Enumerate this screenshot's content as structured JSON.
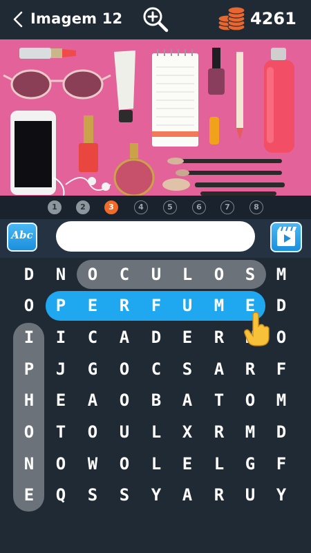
{
  "header": {
    "title": "Imagem 12",
    "coins": "4261"
  },
  "colors": {
    "background": "#1f2a35",
    "found_word": "#6b7279",
    "current_word": "#1fa7ef",
    "active_page": "#f06a2a"
  },
  "icons": [
    "back-icon",
    "zoom-in-icon",
    "coins-icon",
    "abc-hint-icon",
    "video-icon",
    "pointer-hand-icon"
  ],
  "photo": {
    "subject": "cosmetics flat lay on pink background"
  },
  "pager": {
    "pages": [
      "1",
      "2",
      "3",
      "4",
      "5",
      "6",
      "7",
      "8"
    ],
    "completed": 2,
    "current": 3
  },
  "hint_button": {
    "label": "Abc"
  },
  "answer": {
    "value": ""
  },
  "grid": {
    "rows": [
      [
        "D",
        "N",
        "O",
        "C",
        "U",
        "L",
        "O",
        "S",
        "M"
      ],
      [
        "O",
        "P",
        "E",
        "R",
        "F",
        "U",
        "M",
        "E",
        "D"
      ],
      [
        "I",
        "I",
        "C",
        "A",
        "D",
        "E",
        "R",
        "N",
        "O"
      ],
      [
        "P",
        "J",
        "G",
        "O",
        "C",
        "S",
        "A",
        "R",
        "F"
      ],
      [
        "H",
        "E",
        "A",
        "O",
        "B",
        "A",
        "T",
        "O",
        "M"
      ],
      [
        "O",
        "T",
        "O",
        "U",
        "L",
        "X",
        "R",
        "M",
        "D"
      ],
      [
        "N",
        "O",
        "W",
        "O",
        "L",
        "E",
        "L",
        "G",
        "F"
      ],
      [
        "E",
        "Q",
        "S",
        "S",
        "Y",
        "A",
        "R",
        "U",
        "Y"
      ]
    ],
    "found_words": [
      "OCULOS",
      "IPHONE"
    ],
    "current_word": "PERFUME"
  }
}
